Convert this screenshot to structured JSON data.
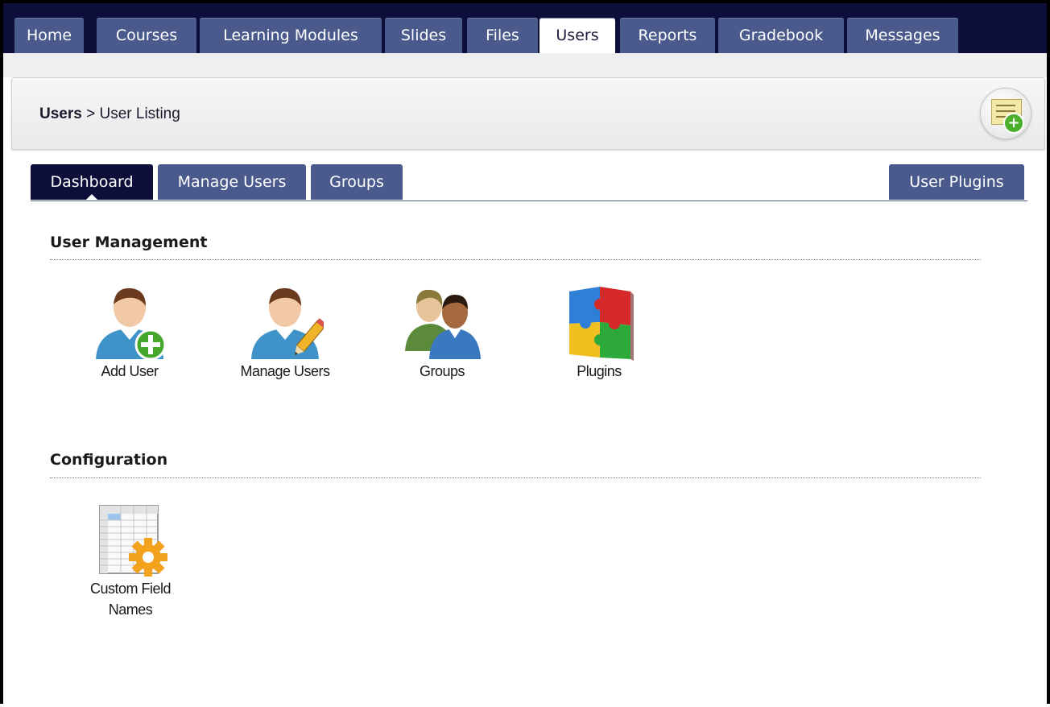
{
  "nav": {
    "tabs": [
      {
        "label": "Home"
      },
      {
        "label": "Courses"
      },
      {
        "label": "Learning Modules"
      },
      {
        "label": "Slides"
      },
      {
        "label": "Files"
      },
      {
        "label": "Users"
      },
      {
        "label": "Reports"
      },
      {
        "label": "Gradebook"
      },
      {
        "label": "Messages"
      }
    ],
    "active": "Users"
  },
  "header": {
    "breadcrumb_root": "Users",
    "breadcrumb_sep": " > ",
    "breadcrumb_page": "User Listing",
    "help_icon": "sticky-note-add-icon"
  },
  "subtabs": {
    "left": [
      {
        "label": "Dashboard"
      },
      {
        "label": "Manage Users"
      },
      {
        "label": "Groups"
      }
    ],
    "right": {
      "label": "User Plugins"
    },
    "active": "Dashboard"
  },
  "sections": {
    "user_management": {
      "title": "User Management",
      "items": [
        {
          "label": "Add User",
          "icon": "add-user-icon"
        },
        {
          "label": "Manage Users",
          "icon": "edit-user-icon"
        },
        {
          "label": "Groups",
          "icon": "groups-icon"
        },
        {
          "label": "Plugins",
          "icon": "puzzle-plugins-icon"
        }
      ]
    },
    "configuration": {
      "title": "Configuration",
      "items": [
        {
          "label_line1": "Custom Field",
          "label_line2": "Names",
          "icon": "table-gear-icon"
        }
      ]
    }
  },
  "colors": {
    "nav_dark": "#0e0e3a",
    "tab_blue": "#4a5a8c",
    "add_green": "#4caf2c",
    "gear_orange": "#f2a21c"
  }
}
